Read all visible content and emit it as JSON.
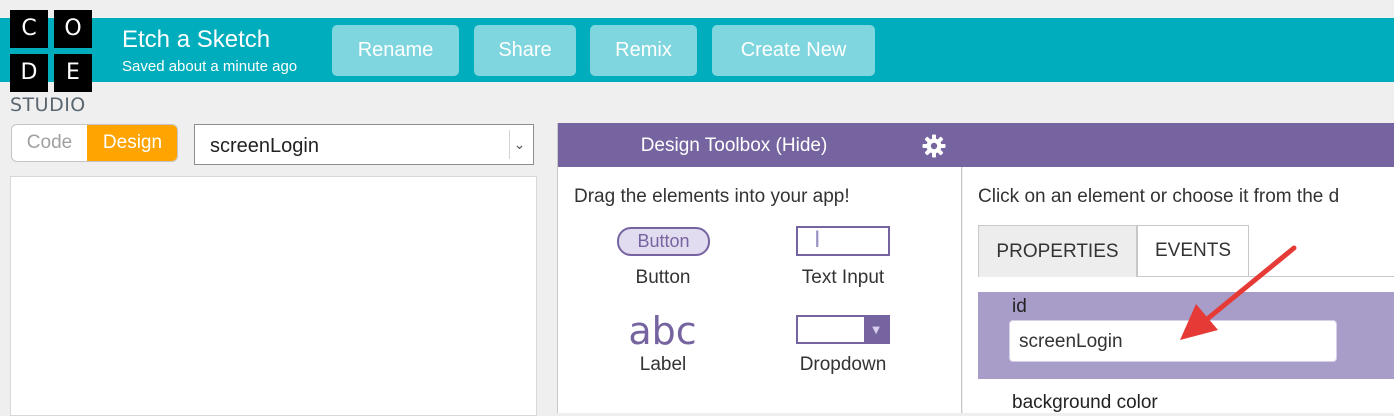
{
  "logo": {
    "letters": [
      "C",
      "O",
      "D",
      "E"
    ],
    "caption": "STUDIO"
  },
  "header": {
    "project_name": "Etch a Sketch",
    "status": "Saved about a minute ago",
    "buttons": [
      "Rename",
      "Share",
      "Remix",
      "Create New"
    ],
    "accent_color": "#00adbc"
  },
  "mode_toggle": {
    "code_label": "Code",
    "design_label": "Design",
    "selected": "Design"
  },
  "screen_select": {
    "value": "screenLogin"
  },
  "toolbox": {
    "title": "Design Toolbox (Hide)",
    "intro": "Drag the elements into your app!",
    "items": [
      {
        "label": "Button",
        "preview_text": "Button",
        "icon": "button-preview-icon"
      },
      {
        "label": "Text Input",
        "preview_text": "I",
        "icon": "text-input-preview-icon"
      },
      {
        "label": "Label",
        "preview_text": "abc",
        "icon": "label-preview-icon"
      },
      {
        "label": "Dropdown",
        "preview_text": "▼",
        "icon": "dropdown-preview-icon"
      }
    ],
    "header_color": "#7664a0"
  },
  "properties": {
    "intro": "Click on an element or choose it from the d",
    "tabs": [
      "PROPERTIES",
      "EVENTS"
    ],
    "active_tab": "PROPERTIES",
    "id_label": "id",
    "id_value": "screenLogin",
    "next_label": "background color"
  },
  "annotation": {
    "color": "#e53a35",
    "icon": "red-arrow-annotation"
  }
}
